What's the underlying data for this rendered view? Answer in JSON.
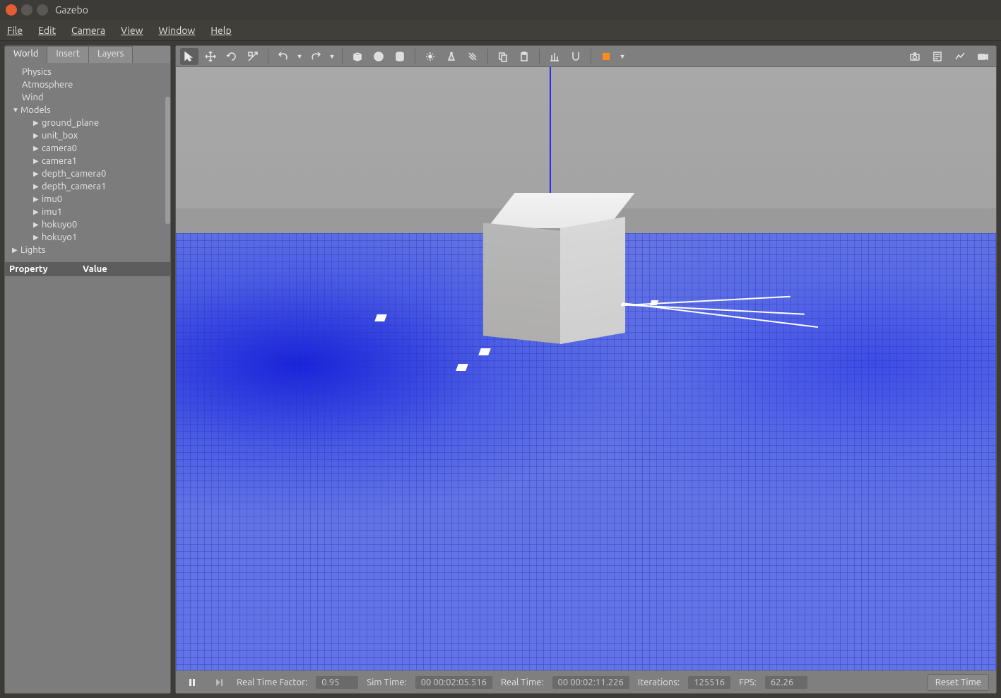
{
  "window": {
    "title": "Gazebo"
  },
  "menubar": [
    "File",
    "Edit",
    "Camera",
    "View",
    "Window",
    "Help"
  ],
  "sidebar": {
    "tabs": [
      "World",
      "Insert",
      "Layers"
    ],
    "active_tab": 0,
    "tree": {
      "top_items": [
        "Physics",
        "Atmosphere",
        "Wind"
      ],
      "models_label": "Models",
      "models": [
        "ground_plane",
        "unit_box",
        "camera0",
        "camera1",
        "depth_camera0",
        "depth_camera1",
        "imu0",
        "imu1",
        "hokuyo0",
        "hokuyo1"
      ],
      "lights_label": "Lights"
    },
    "property_header": {
      "property": "Property",
      "value": "Value"
    }
  },
  "toolbar": {
    "icons": [
      "select-arrow",
      "translate",
      "rotate",
      "scale",
      "undo",
      "undo-menu",
      "redo",
      "redo-menu",
      "box",
      "sphere",
      "cylinder",
      "point-light",
      "spot-light",
      "directional-light",
      "copy",
      "paste",
      "align",
      "snap",
      "selection-highlight",
      "selection-menu"
    ],
    "right_icons": [
      "screenshot",
      "logging",
      "plot",
      "record"
    ]
  },
  "status": {
    "rtf_label": "Real Time Factor:",
    "rtf_value": "0.95",
    "sim_label": "Sim Time:",
    "sim_value": "00 00:02:05.516",
    "real_label": "Real Time:",
    "real_value": "00 00:02:11.226",
    "iter_label": "Iterations:",
    "iter_value": "125516",
    "fps_label": "FPS:",
    "fps_value": "62.26",
    "reset_label": "Reset Time"
  }
}
